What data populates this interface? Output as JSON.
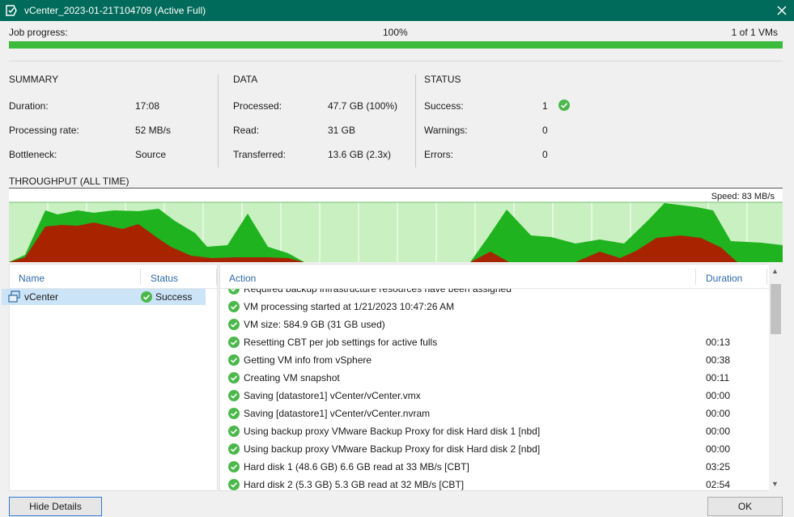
{
  "window": {
    "title": "vCenter_2023-01-21T104709 (Active Full)"
  },
  "progress": {
    "label": "Job progress:",
    "percent_text": "100%",
    "vms_text": "1 of 1 VMs",
    "fraction": 1.0
  },
  "summary": {
    "heading": "SUMMARY",
    "items": [
      {
        "label": "Duration:",
        "value": "17:08"
      },
      {
        "label": "Processing rate:",
        "value": "52 MB/s"
      },
      {
        "label": "Bottleneck:",
        "value": "Source"
      }
    ]
  },
  "data": {
    "heading": "DATA",
    "items": [
      {
        "label": "Processed:",
        "value": "47.7 GB (100%)"
      },
      {
        "label": "Read:",
        "value": "31 GB"
      },
      {
        "label": "Transferred:",
        "value": "13.6 GB (2.3x)"
      }
    ]
  },
  "status": {
    "heading": "STATUS",
    "items": [
      {
        "label": "Success:",
        "value": "1"
      },
      {
        "label": "Warnings:",
        "value": "0"
      },
      {
        "label": "Errors:",
        "value": "0"
      }
    ]
  },
  "throughput": {
    "heading": "THROUGHPUT (ALL TIME)",
    "speed": "Speed: 83 MB/s"
  },
  "vm_list": {
    "columns": [
      "Name",
      "Status"
    ],
    "rows": [
      {
        "name": "vCenter",
        "status": "Success"
      }
    ]
  },
  "log": {
    "columns": [
      "Action",
      "Duration"
    ],
    "rows": [
      {
        "text": "Required backup infrastructure resources have been assigned",
        "duration": ""
      },
      {
        "text": "VM processing started at 1/21/2023 10:47:26 AM",
        "duration": ""
      },
      {
        "text": "VM size: 584.9 GB (31 GB used)",
        "duration": ""
      },
      {
        "text": "Resetting CBT per job settings for active fulls",
        "duration": "00:13"
      },
      {
        "text": "Getting VM info from vSphere",
        "duration": "00:38"
      },
      {
        "text": "Creating VM snapshot",
        "duration": "00:11"
      },
      {
        "text": "Saving [datastore1] vCenter/vCenter.vmx",
        "duration": "00:00"
      },
      {
        "text": "Saving [datastore1] vCenter/vCenter.nvram",
        "duration": "00:00"
      },
      {
        "text": "Using backup proxy VMware Backup Proxy for disk Hard disk 1 [nbd]",
        "duration": "00:00"
      },
      {
        "text": "Using backup proxy VMware Backup Proxy for disk Hard disk 2 [nbd]",
        "duration": "00:00"
      },
      {
        "text": "Hard disk 1 (48.6 GB) 6.6 GB read at 33 MB/s [CBT]",
        "duration": "03:25"
      },
      {
        "text": "Hard disk 2 (5.3 GB) 5.3 GB read at 32 MB/s [CBT]",
        "duration": "02:54"
      }
    ]
  },
  "buttons": {
    "hide_details": "Hide Details",
    "ok": "OK"
  },
  "colors": {
    "titlebar": "#006b5a",
    "progress": "#3cba3c",
    "chart_green": "#1fb31f",
    "chart_red": "#a82400",
    "chart_bg": "#c8f0c0",
    "success": "#4cb84c"
  },
  "icons": {
    "app": "veeam-job-icon",
    "close": "close-icon",
    "success": "check-circle-icon",
    "vm": "vm-icon"
  }
}
